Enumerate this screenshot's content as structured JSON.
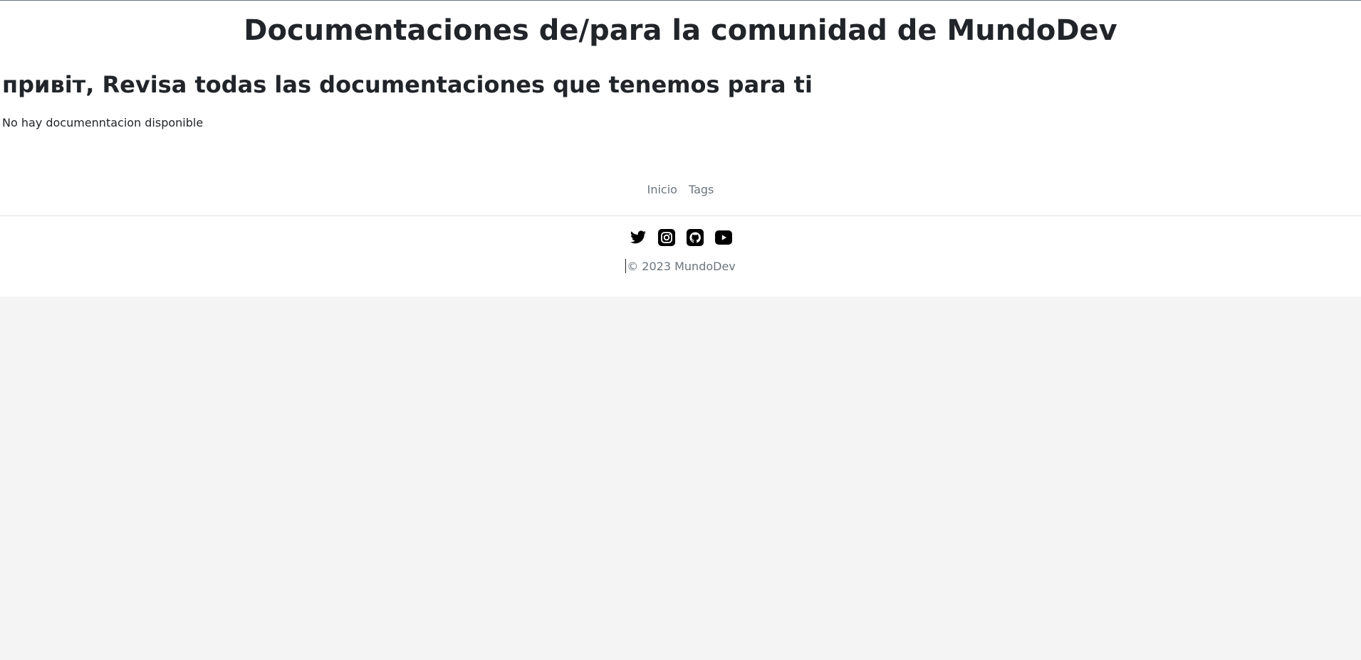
{
  "header": {
    "title": "Documentaciones de/para la comunidad de MundoDev"
  },
  "main": {
    "greeting": "привіт, Revisa todas las documentaciones que tenemos para ti",
    "empty_message": "No hay documenntacion disponible"
  },
  "footer": {
    "nav": [
      {
        "label": "Inicio"
      },
      {
        "label": "Tags"
      }
    ],
    "social": [
      {
        "icon": "twitter-icon"
      },
      {
        "icon": "instagram-icon"
      },
      {
        "icon": "github-icon"
      },
      {
        "icon": "youtube-icon"
      }
    ],
    "copyright": "© 2023 MundoDev"
  },
  "colors": {
    "text": "#212529",
    "muted": "#6c757d",
    "page_background": "#ffffff",
    "outer_background": "#f4f4f4"
  }
}
